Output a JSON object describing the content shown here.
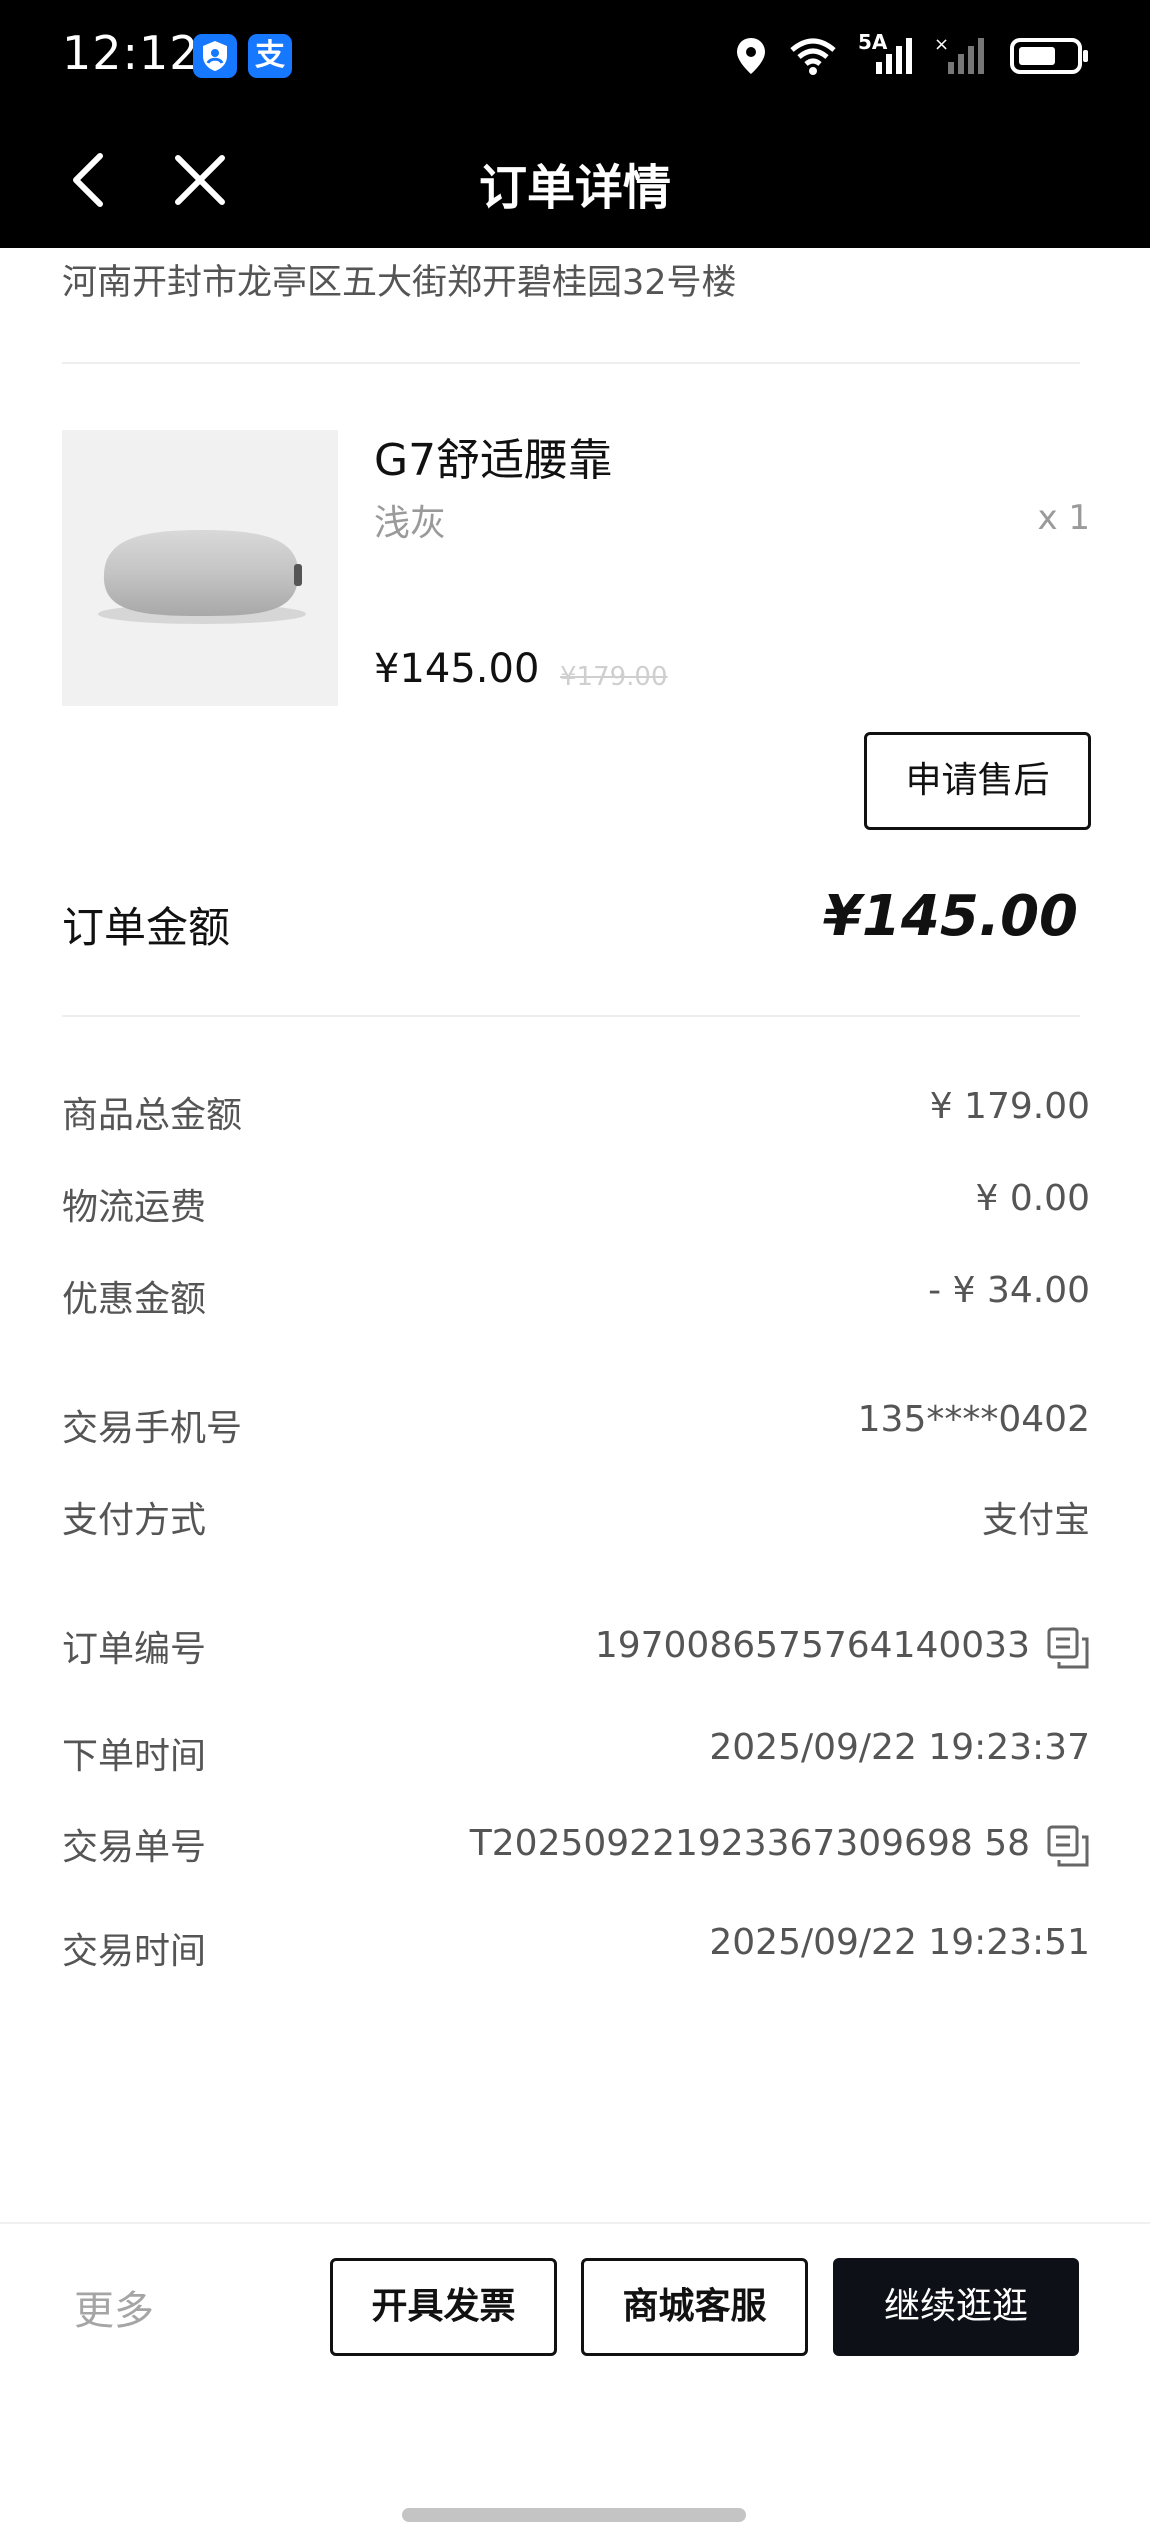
{
  "status_bar": {
    "time": "12:12",
    "badge_1_icon": "shield-user-icon",
    "badge_2_label": "支",
    "network_label": "5A"
  },
  "nav": {
    "title": "订单详情",
    "back_icon": "chevron-left-icon",
    "close_icon": "close-icon"
  },
  "address": "河南开封市龙亭区五大街郑开碧桂园32号楼",
  "product": {
    "name": "G7舒适腰靠",
    "variant": "浅灰",
    "quantity": "x 1",
    "price": "¥145.00",
    "original_price": "¥179.00",
    "after_sale_label": "申请售后"
  },
  "order_total": {
    "label": "订单金额",
    "value": "¥145.00"
  },
  "details": [
    {
      "label": "商品总金额",
      "value": "¥ 179.00"
    },
    {
      "label": "物流运费",
      "value": "¥ 0.00"
    },
    {
      "label": "优惠金额",
      "value": "- ¥ 34.00"
    },
    {
      "label": "交易手机号",
      "value": "135****0402"
    },
    {
      "label": "支付方式",
      "value": "支付宝"
    },
    {
      "label": "订单编号",
      "value": "1970086575764140033"
    },
    {
      "label": "下单时间",
      "value": "2025/09/22 19:23:37"
    },
    {
      "label": "交易单号",
      "value": "T202509221923367309698 58"
    },
    {
      "label": "交易时间",
      "value": "2025/09/22 19:23:51"
    }
  ],
  "bottom": {
    "more_label": "更多",
    "invoice_label": "开具发票",
    "service_label": "商城客服",
    "continue_label": "继续逛逛"
  },
  "colors": {
    "header_bg": "#000000",
    "primary_button_bg": "#0d1117",
    "alipay_blue": "#1677ff",
    "muted_text": "#9a9a9a"
  }
}
